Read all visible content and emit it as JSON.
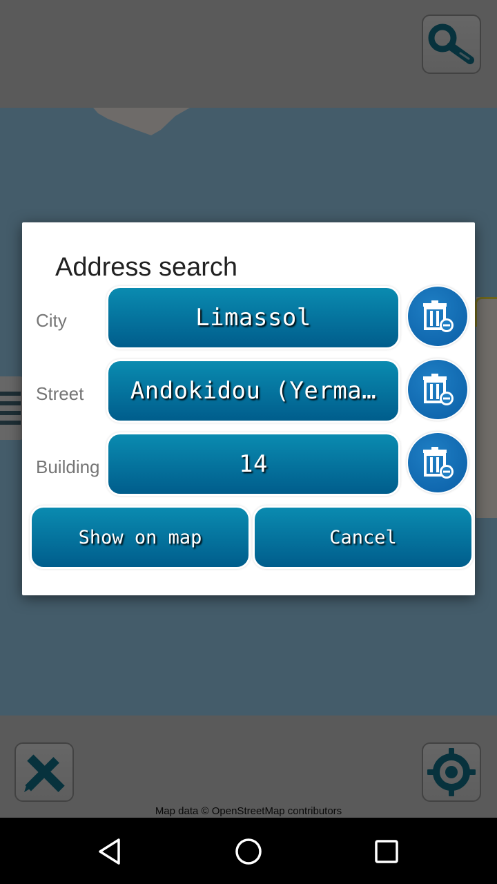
{
  "map": {
    "attribution": "Map data © OpenStreetMap contributors",
    "toolbar": {
      "search_icon": "magnifier-icon",
      "ruler_icon": "ruler-pencil-icon",
      "locate_icon": "locate-target-icon"
    }
  },
  "dialog": {
    "title": "Address search",
    "fields": [
      {
        "label": "City",
        "value": "Limassol",
        "clear_icon": "trash-minus-icon"
      },
      {
        "label": "Street",
        "value": "Andokidou (Yerma…",
        "clear_icon": "trash-minus-icon"
      },
      {
        "label": "Building",
        "value": "14",
        "clear_icon": "trash-minus-icon"
      }
    ],
    "show_on_map_label": "Show on map",
    "cancel_label": "Cancel"
  },
  "colors": {
    "button_top": "#0a8bb0",
    "button_bottom": "#005d8c",
    "icon_teal": "#0f6a80",
    "delete_blue": "#0a5ea6"
  },
  "navbar": {
    "back_icon": "back-triangle-icon",
    "home_icon": "home-circle-icon",
    "recents_icon": "recents-square-icon"
  }
}
